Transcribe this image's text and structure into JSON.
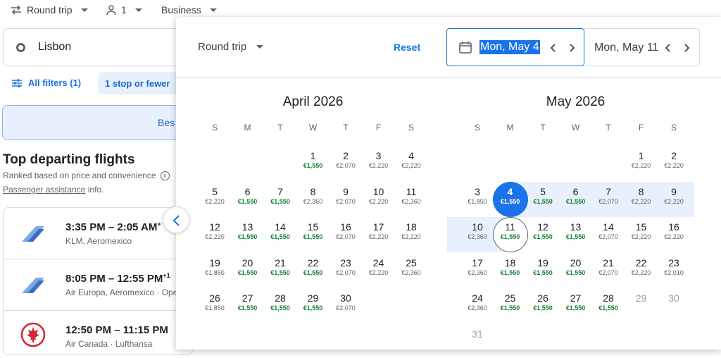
{
  "topbar": {
    "trip_type": "Round trip",
    "passengers": "1",
    "cabin": "Business"
  },
  "search": {
    "origin": "Lisbon"
  },
  "filters": {
    "all_filters": "All filters (1)",
    "stops_chip": "1 stop or fewer"
  },
  "tabs": {
    "best_partial": "Bes"
  },
  "section": {
    "title": "Top departing flights",
    "subtitle": "Ranked based on price and convenience",
    "assist_link": "Passenger assistance",
    "assist_suffix": " info."
  },
  "flights": [
    {
      "times": "3:35 PM – 2:05 AM",
      "sup": "+",
      "airlines": "KLM, Aeromexico"
    },
    {
      "times": "8:05 PM – 12:55 PM",
      "sup": "+1",
      "airlines": "Air Europa, Aeromexico · Ope"
    },
    {
      "times": "12:50 PM – 11:15 PM",
      "sup": "",
      "airlines": "Air Canada · Lufthansa"
    }
  ],
  "picker": {
    "trip_type": "Round trip",
    "reset": "Reset",
    "depart_date": "Mon, May 4",
    "return_date": "Mon, May 11"
  },
  "weekdays": [
    "S",
    "M",
    "T",
    "W",
    "T",
    "F",
    "S"
  ],
  "months": [
    {
      "title": "April 2026",
      "first_col": 3,
      "days": [
        {
          "d": "1",
          "p": "€1,550",
          "c": true
        },
        {
          "d": "2",
          "p": "€2,070"
        },
        {
          "d": "3",
          "p": "€2,220"
        },
        {
          "d": "4",
          "p": "€2,220"
        },
        {
          "d": "5",
          "p": "€2,220"
        },
        {
          "d": "6",
          "p": "€1,550",
          "c": true
        },
        {
          "d": "7",
          "p": "€1,550",
          "c": true
        },
        {
          "d": "8",
          "p": "€2,360"
        },
        {
          "d": "9",
          "p": "€2,070"
        },
        {
          "d": "10",
          "p": "€2,220"
        },
        {
          "d": "11",
          "p": "€2,360"
        },
        {
          "d": "12",
          "p": "€2,220"
        },
        {
          "d": "13",
          "p": "€1,550",
          "c": true
        },
        {
          "d": "14",
          "p": "€1,550",
          "c": true
        },
        {
          "d": "15",
          "p": "€1,550",
          "c": true
        },
        {
          "d": "16",
          "p": "€2,070"
        },
        {
          "d": "17",
          "p": "€2,220"
        },
        {
          "d": "18",
          "p": "€2,220"
        },
        {
          "d": "19",
          "p": "€1,850"
        },
        {
          "d": "20",
          "p": "€1,550",
          "c": true
        },
        {
          "d": "21",
          "p": "€1,550",
          "c": true
        },
        {
          "d": "22",
          "p": "€1,550",
          "c": true
        },
        {
          "d": "23",
          "p": "€2,070"
        },
        {
          "d": "24",
          "p": "€2,220"
        },
        {
          "d": "25",
          "p": "€2,360"
        },
        {
          "d": "26",
          "p": "€1,850"
        },
        {
          "d": "27",
          "p": "€1,550",
          "c": true
        },
        {
          "d": "28",
          "p": "€1,550",
          "c": true
        },
        {
          "d": "29",
          "p": "€1,550",
          "c": true
        },
        {
          "d": "30",
          "p": "€2,070"
        }
      ]
    },
    {
      "title": "May 2026",
      "first_col": 5,
      "days": [
        {
          "d": "1",
          "p": "€2,220"
        },
        {
          "d": "2",
          "p": "€2,220"
        },
        {
          "d": "3",
          "p": "€1,850"
        },
        {
          "d": "4",
          "p": "€1,550",
          "c": true,
          "sel": "start"
        },
        {
          "d": "5",
          "p": "€1,550",
          "c": true
        },
        {
          "d": "6",
          "p": "€1,550",
          "c": true
        },
        {
          "d": "7",
          "p": "€2,070"
        },
        {
          "d": "8",
          "p": "€2,220"
        },
        {
          "d": "9",
          "p": "€2,220"
        },
        {
          "d": "10",
          "p": "€2,360"
        },
        {
          "d": "11",
          "p": "€1,550",
          "c": true,
          "sel": "end"
        },
        {
          "d": "12",
          "p": "€1,550",
          "c": true
        },
        {
          "d": "13",
          "p": "€1,550",
          "c": true
        },
        {
          "d": "14",
          "p": "€2,070"
        },
        {
          "d": "15",
          "p": "€2,220"
        },
        {
          "d": "16",
          "p": "€2,220"
        },
        {
          "d": "17",
          "p": "€2,360"
        },
        {
          "d": "18",
          "p": "€1,550",
          "c": true
        },
        {
          "d": "19",
          "p": "€1,550",
          "c": true
        },
        {
          "d": "20",
          "p": "€1,550",
          "c": true
        },
        {
          "d": "21",
          "p": "€2,070"
        },
        {
          "d": "22",
          "p": "€2,220"
        },
        {
          "d": "23",
          "p": "€2,010"
        },
        {
          "d": "24",
          "p": "€2,360"
        },
        {
          "d": "25",
          "p": "€1,550",
          "c": true
        },
        {
          "d": "26",
          "p": "€1,550",
          "c": true
        },
        {
          "d": "27",
          "p": "€1,550",
          "c": true
        },
        {
          "d": "28",
          "p": "€1,550",
          "c": true
        },
        {
          "d": "29",
          "p": "",
          "g": true
        },
        {
          "d": "30",
          "p": "",
          "g": true
        },
        {
          "d": "31",
          "p": "",
          "g": true
        }
      ]
    }
  ]
}
